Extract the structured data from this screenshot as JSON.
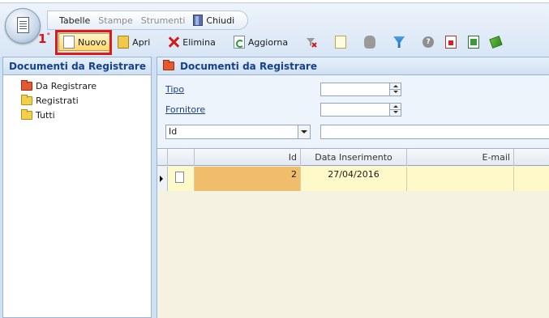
{
  "menubar": {
    "items": [
      {
        "label": "Tabelle",
        "enabled": true
      },
      {
        "label": "Stampe",
        "enabled": false
      },
      {
        "label": "Strumenti",
        "enabled": false
      }
    ],
    "close_label": "Chiudi"
  },
  "toolbar": {
    "new_label": "Nuovo",
    "open_label": "Apri",
    "delete_label": "Elimina",
    "refresh_label": "Aggiorna"
  },
  "annotation": {
    "step": "1",
    "step_suffix": "°",
    "highlight_color": "#e01818"
  },
  "left_panel": {
    "title": "Documenti da Registrare",
    "tree": [
      {
        "label": "Da Registrare",
        "icon": "open-folder-red-icon"
      },
      {
        "label": "Registrati",
        "icon": "folder-icon"
      },
      {
        "label": "Tutti",
        "icon": "folder-icon"
      }
    ]
  },
  "right_panel": {
    "title": "Documenti da Registrare",
    "filters": {
      "tipo_label": "Tipo",
      "fornitore_label": "Fornitore",
      "field_select_value": "Id",
      "tipo_value": "",
      "fornitore_value": "",
      "search_value": ""
    },
    "grid": {
      "columns": [
        "",
        "",
        "Id",
        "Data Inserimento",
        "E-mail"
      ],
      "rows": [
        {
          "id": "2",
          "data_inserimento": "27/04/2016",
          "email": ""
        }
      ]
    }
  },
  "colors": {
    "accent_header_text": "#15428b",
    "selected_cell": "#f0be6a",
    "row_background": "#fff8c8",
    "active_button": "#ffd86a"
  }
}
